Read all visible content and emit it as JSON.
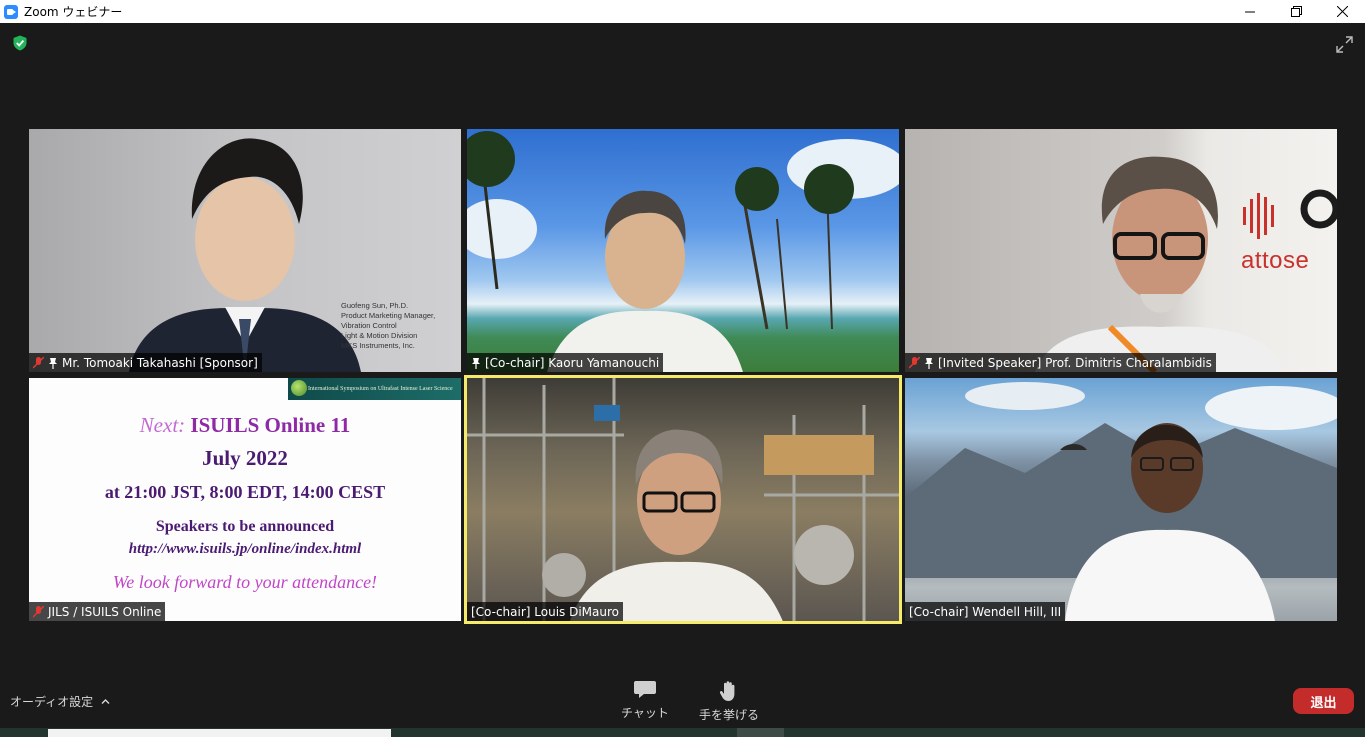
{
  "window": {
    "title": "Zoom ウェビナー",
    "minimize": "—",
    "restore": "❐",
    "close": "✕"
  },
  "participants": [
    {
      "name": "Mr. Tomoaki Takahashi [Sponsor]",
      "muted": true,
      "pinned": true
    },
    {
      "name": "[Co-chair] Kaoru Yamanouchi",
      "muted": false,
      "pinned": true
    },
    {
      "name": "[Invited Speaker] Prof. Dimitris Charalambidis",
      "muted": true,
      "pinned": true
    },
    {
      "name": "JILS / ISUILS Online",
      "muted": true,
      "pinned": false
    },
    {
      "name": "[Co-chair] Louis DiMauro",
      "muted": false,
      "pinned": false,
      "active_speaker": true
    },
    {
      "name": "[Co-chair] Wendell Hill, III",
      "muted": false,
      "pinned": false
    }
  ],
  "tile1_caption": [
    "Guofeng Sun, Ph.D.",
    "Product Marketing Manager,",
    "Vibration Control",
    "Light & Motion Division",
    "MKS Instruments, Inc."
  ],
  "tile3_brand": "attose",
  "slide": {
    "banner": "International Symposium on Ultrafast Intense Laser Science",
    "next_prefix": "Next:",
    "title": "ISUILS Online 11",
    "date": "July 2022",
    "time": "at 21:00 JST, 8:00 EDT, 14:00 CEST",
    "speakers": "Speakers to be announced",
    "url": "http://www.isuils.jp/online/index.html",
    "closing": "We look forward to your attendance!"
  },
  "toolbar": {
    "audio_setting": "オーディオ設定",
    "chat": "チャット",
    "raise_hand": "手を挙げる",
    "leave": "退出"
  },
  "colors": {
    "active_speaker_border": "#f5ea6a",
    "leave_button": "#c42b2b",
    "muted_icon": "#e0392f"
  }
}
